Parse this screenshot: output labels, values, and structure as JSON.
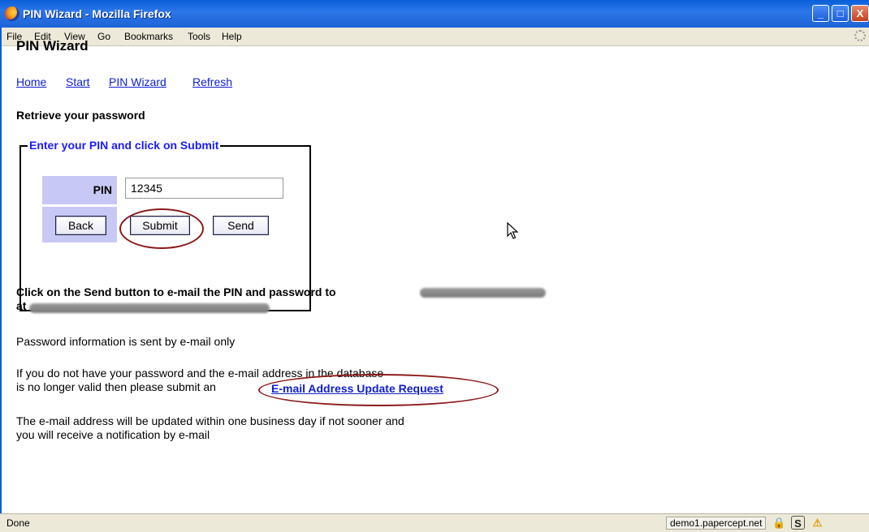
{
  "window": {
    "title": "PIN Wizard - Mozilla Firefox",
    "controls": {
      "minimize": "_",
      "maximize": "□",
      "close": "X"
    }
  },
  "menubar": {
    "items": [
      "File",
      "Edit",
      "View",
      "Go",
      "Bookmarks",
      "Tools",
      "Help"
    ]
  },
  "page": {
    "title": "PIN Wizard",
    "nav": [
      "Home",
      "Start",
      "PIN Wizard",
      "Refresh"
    ],
    "section_heading": "Retrieve your password",
    "form": {
      "legend": "Enter your PIN and click on Submit",
      "pin_label": "PIN",
      "pin_value": "12345",
      "buttons": {
        "back": "Back",
        "submit": "Submit",
        "send": "Send"
      }
    },
    "send_line1": "Click on the Send button to e-mail the PIN and password to",
    "send_line2": "at",
    "info": "Password information is sent by e-mail only",
    "update_line1": "If you do not have your password and the e-mail address in the database",
    "update_line2": "is no longer valid then please submit an",
    "update_link": "E-mail Address Update Request",
    "notice_line1": "The e-mail address will be updated within one business day if not sooner and",
    "notice_line2": "you will receive a notification by e-mail"
  },
  "status": {
    "text": "Done",
    "domain": "demo1.papercept.net",
    "icons": [
      "lock-icon",
      "s-icon",
      "warning-icon"
    ]
  },
  "colors": {
    "link": "#1020d0",
    "legend": "#1a1aff",
    "cell_bg": "#c8c8f5",
    "annotation": "#8b1a1a"
  }
}
